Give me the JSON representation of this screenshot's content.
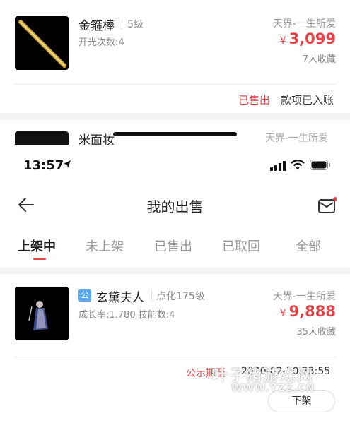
{
  "top_listing": {
    "item_name": "金箍棒",
    "grade": "5级",
    "attr": "开光次数:4",
    "server": "天界-一生所爱",
    "price_currency": "¥",
    "price": "3,099",
    "favorites": "7人收藏",
    "status": "已售出",
    "payment_status": "款项已入账"
  },
  "partial_next_item": {
    "name_fragment": "米面妆",
    "server_fragment": "天界-一生所爱"
  },
  "status_bar": {
    "time": "13:57"
  },
  "nav": {
    "title": "我的出售",
    "back_icon": "arrow-left-icon",
    "mail_icon": "mail-icon"
  },
  "tabs": [
    {
      "label": "上架中",
      "active": true
    },
    {
      "label": "未上架",
      "active": false
    },
    {
      "label": "已售出",
      "active": false
    },
    {
      "label": "已取回",
      "active": false
    },
    {
      "label": "全部",
      "active": false
    }
  ],
  "listing": {
    "badge": "公",
    "item_name": "玄黛夫人",
    "grade": "点化175级",
    "attrs": "成长率:1.780  技能数:4",
    "server": "天界-一生所爱",
    "price_currency": "¥",
    "price": "9,888",
    "favorites": "35人收藏",
    "status_label": "公示期至",
    "status_time": "2020-02-10 23:55",
    "delist_label": "下架"
  },
  "watermark": {
    "line1": "叶子猪游戏网",
    "line2": "WWW.YZZ.CN"
  },
  "colors": {
    "accent_red": "#e0454b",
    "badge_blue": "#5aa9f0"
  }
}
